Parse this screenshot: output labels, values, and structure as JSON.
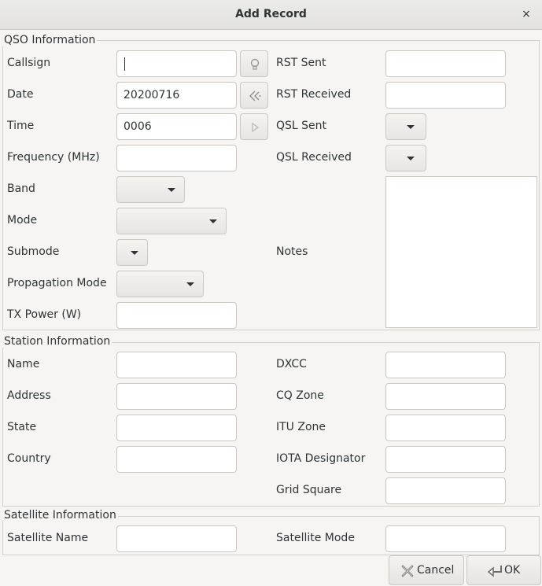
{
  "window": {
    "title": "Add Record",
    "close_glyph": "×"
  },
  "qso": {
    "section_title": "QSO Information",
    "callsign_label": "Callsign",
    "date_label": "Date",
    "date_value": "20200716",
    "time_label": "Time",
    "time_value": "0006",
    "frequency_label": "Frequency (MHz)",
    "band_label": "Band",
    "mode_label": "Mode",
    "submode_label": "Submode",
    "propagation_label": "Propagation Mode",
    "txpower_label": "TX Power (W)",
    "rst_sent_label": "RST Sent",
    "rst_received_label": "RST Received",
    "qsl_sent_label": "QSL Sent",
    "qsl_received_label": "QSL Received",
    "notes_label": "Notes"
  },
  "station": {
    "section_title": "Station Information",
    "name_label": "Name",
    "address_label": "Address",
    "state_label": "State",
    "country_label": "Country",
    "dxcc_label": "DXCC",
    "cq_zone_label": "CQ Zone",
    "itu_zone_label": "ITU Zone",
    "iota_label": "IOTA Designator",
    "grid_label": "Grid Square"
  },
  "satellite": {
    "section_title": "Satellite Information",
    "name_label": "Satellite Name",
    "mode_label": "Satellite Mode"
  },
  "buttons": {
    "cancel_label": "Cancel",
    "ok_label": "OK"
  },
  "icons": {
    "lookup": "lightbulb-icon",
    "today": "rewind-icon",
    "now": "play-icon",
    "cancel": "cancel-x-icon",
    "ok": "enter-arrow-icon"
  }
}
